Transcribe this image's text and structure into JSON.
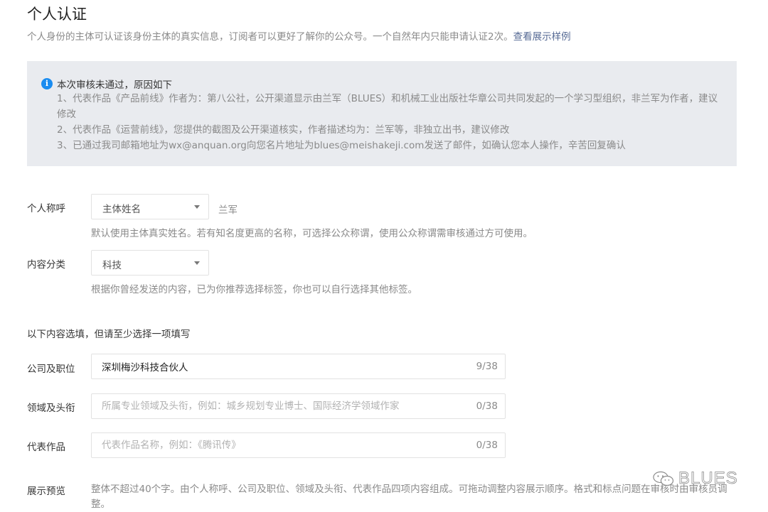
{
  "header": {
    "title": "个人认证",
    "description": "个人身份的主体可认证该身份主体的真实信息，订阅者可以更好了解你的公众号。一个自然年内只能申请认证2次。",
    "example_link": "查看展示样例"
  },
  "notice": {
    "icon": "info-icon",
    "title": "本次审核未通过，原因如下",
    "items": [
      "1、代表作品《产品前线》作者为：第八公社，公开渠道显示由兰军（BLUES）和机械工业出版社华章公司共同发起的一个学习型组织，非兰军为作者，建议修改",
      "2、代表作品《运营前线》，您提供的截图及公开渠道核实，作者描述均为：兰军等，非独立出书，建议修改",
      "3、已通过我司邮箱地址为wx@anquan.org向您名片地址为blues@meishakeji.com发送了邮件，如确认您本人操作，辛苦回复确认"
    ]
  },
  "form": {
    "personal_title": {
      "label": "个人称呼",
      "selected": "主体姓名",
      "value": "兰军",
      "hint": "默认使用主体真实姓名。若有知名度更高的名称，可选择公众称谓，使用公众称谓需审核通过方可使用。"
    },
    "category": {
      "label": "内容分类",
      "selected": "科技",
      "hint": "根据你曾经发送的内容，已为你推荐选择标签，你也可以自行选择其他标签。"
    },
    "optional_note": "以下内容选填，但请至少选择一项填写",
    "company": {
      "label": "公司及职位",
      "value": "深圳梅沙科技合伙人",
      "placeholder": "",
      "counter": "9/38"
    },
    "field": {
      "label": "领域及头衔",
      "value": "",
      "placeholder": "所属专业领域及头衔，例如：城乡规划专业博士、国际经济学领域作家",
      "counter": "0/38"
    },
    "works": {
      "label": "代表作品",
      "value": "",
      "placeholder": "代表作品名称，例如：《腾讯传》",
      "counter": "0/38"
    },
    "preview": {
      "label": "展示预览",
      "text": "整体不超过40个字。由个人称呼、公司及职位、领域及头衔、代表作品四项内容组成。可拖动调整内容展示顺序。格式和标点问题在审核时由审核员调整。"
    }
  },
  "watermark": {
    "icon": "wechat-icon",
    "text": "BLUES"
  }
}
